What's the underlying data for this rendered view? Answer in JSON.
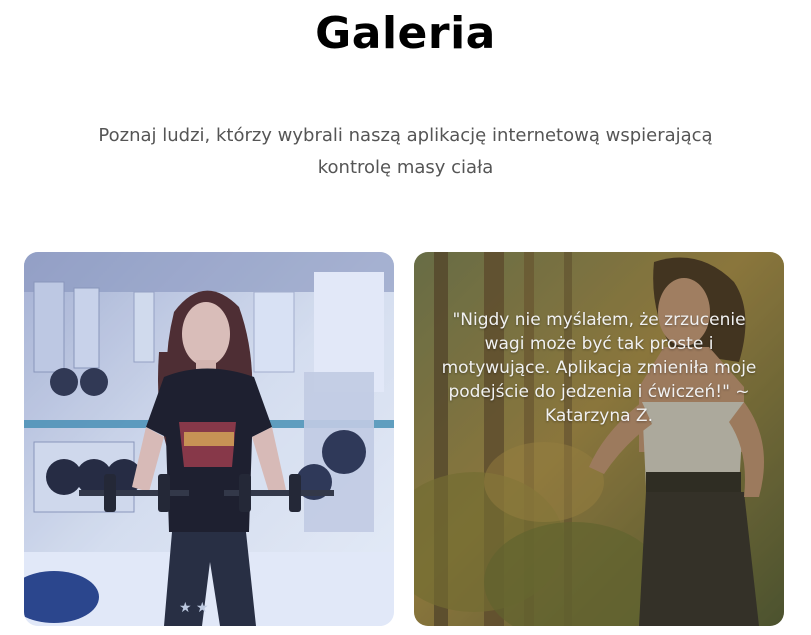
{
  "gallery": {
    "title": "Galeria",
    "subtitle": "Poznaj ludzi, którzy wybrali naszą aplikację internetową wspierającą kontrolę masy ciała",
    "cards": [
      {
        "image": "woman-lifting-dumbbells-gym-photo"
      },
      {
        "image": "woman-running-outdoors-photo",
        "quote": "\"Nigdy nie myślałem, że zrzucenie wagi może być tak proste i motywujące. Aplikacja zmieniła moje podejście do jedzenia i ćwiczeń!\" ~ Katarzyna Z."
      }
    ]
  }
}
